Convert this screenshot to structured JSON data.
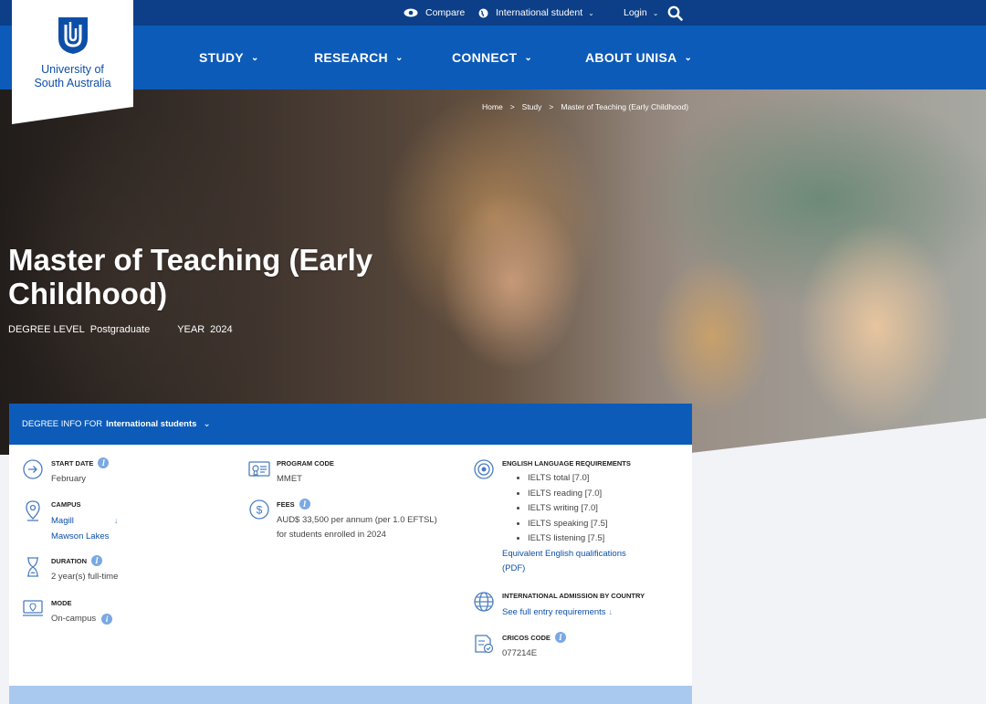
{
  "topbar": {
    "compare": "Compare",
    "student_type": "International student",
    "login": "Login"
  },
  "logo": {
    "line1": "University of",
    "line2": "South Australia"
  },
  "nav": [
    {
      "label": "STUDY"
    },
    {
      "label": "RESEARCH"
    },
    {
      "label": "CONNECT"
    },
    {
      "label": "ABOUT UNISA"
    }
  ],
  "breadcrumb": {
    "home": "Home",
    "study": "Study",
    "current": "Master of Teaching (Early Childhood)",
    "sep": ">"
  },
  "hero": {
    "title": "Master of Teaching (Early Childhood)",
    "degree_level_label": "DEGREE LEVEL",
    "degree_level": "Postgraduate",
    "year_label": "YEAR",
    "year": "2024"
  },
  "degree_info": {
    "prefix": "DEGREE INFO FOR",
    "audience": "International students"
  },
  "details": {
    "start_date": {
      "label": "START DATE",
      "value": "February"
    },
    "campus": {
      "label": "CAMPUS",
      "values": [
        "Magill",
        "Mawson Lakes"
      ]
    },
    "duration": {
      "label": "DURATION",
      "value": "2 year(s) full-time"
    },
    "mode": {
      "label": "MODE",
      "value": "On-campus"
    },
    "program_code": {
      "label": "PROGRAM CODE",
      "value": "MMET"
    },
    "fees": {
      "label": "FEES",
      "line1": "AUD$ 33,500 per annum (per 1.0 EFTSL)",
      "line2": "for students enrolled in 2024"
    },
    "english": {
      "label": "ENGLISH LANGUAGE REQUIREMENTS",
      "items": [
        "IELTS total [7.0]",
        "IELTS reading [7.0]",
        "IELTS writing [7.0]",
        "IELTS speaking [7.5]",
        "IELTS listening [7.5]"
      ],
      "link_line1": "Equivalent English qualifications",
      "link_line2": "(PDF)"
    },
    "admission": {
      "label": "INTERNATIONAL ADMISSION BY COUNTRY",
      "link": "See full entry requirements"
    },
    "cricos": {
      "label": "CRICOS CODE",
      "value": "077214E"
    }
  },
  "colors": {
    "primary_dark": "#0c3f87",
    "primary": "#0d5bb8",
    "link": "#0d4fa8",
    "info": "#7aa8e3"
  }
}
